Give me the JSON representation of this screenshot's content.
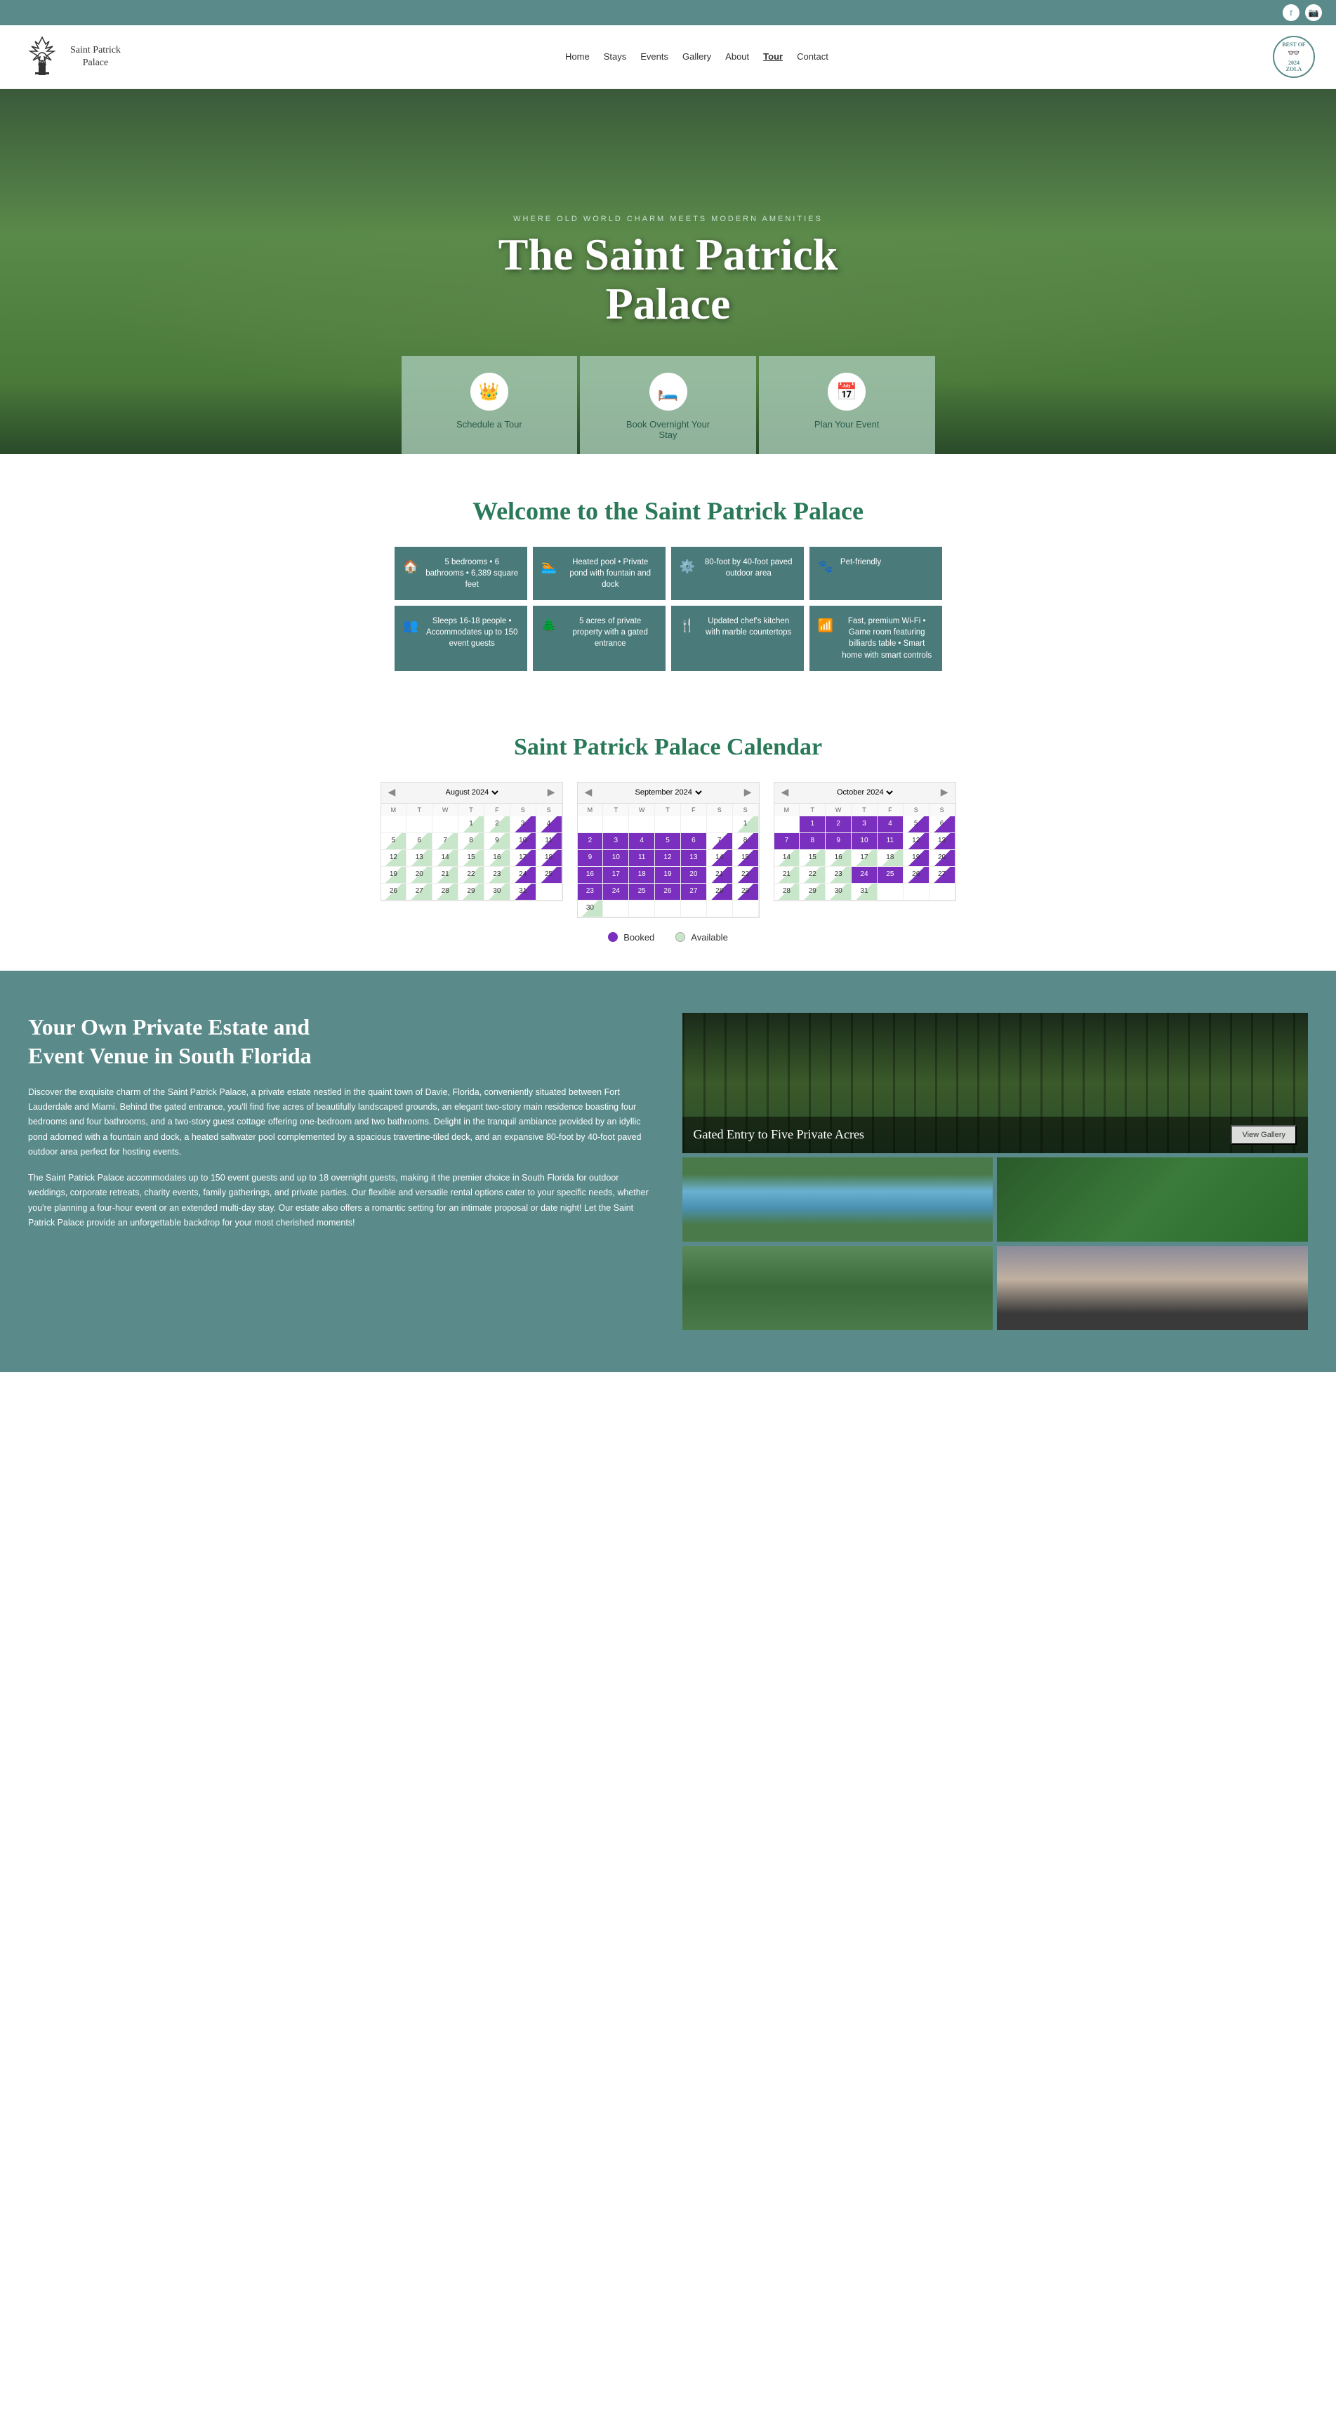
{
  "topbar": {
    "facebook_icon": "f",
    "instagram_icon": "ig"
  },
  "navbar": {
    "logo_line1": "Saint Patrick",
    "logo_line2": "Palace",
    "links": [
      {
        "label": "Home",
        "active": false
      },
      {
        "label": "Stays",
        "active": false
      },
      {
        "label": "Events",
        "active": false
      },
      {
        "label": "Gallery",
        "active": false
      },
      {
        "label": "About",
        "active": false
      },
      {
        "label": "Tour",
        "active": true
      },
      {
        "label": "Contact",
        "active": false
      }
    ],
    "badge_line1": "BEST OF",
    "badge_line2": "2024",
    "badge_line3": "ZOLA"
  },
  "hero": {
    "subtitle": "WHERE OLD WORLD CHARM MEETS MODERN AMENITIES",
    "title_line1": "The Saint Patrick",
    "title_line2": "Palace",
    "cta1": "Schedule a Tour",
    "cta2_line1": "Book Overnight Your",
    "cta2_line2": "Stay",
    "cta3": "Plan Your Event"
  },
  "welcome": {
    "heading": "Welcome to the Saint Patrick Palace"
  },
  "features": [
    {
      "icon": "🏠",
      "text": "5 bedrooms • 6 bathrooms • 6,389 square feet"
    },
    {
      "icon": "🏊",
      "text": "Heated pool • Private pond with fountain and dock"
    },
    {
      "icon": "⚙️",
      "text": "80-foot by 40-foot paved outdoor area"
    },
    {
      "icon": "🐾",
      "text": "Pet-friendly"
    },
    {
      "icon": "👥",
      "text": "Sleeps 16-18 people • Accommodates up to 150 event guests"
    },
    {
      "icon": "🌲",
      "text": "5 acres of private property with a gated entrance"
    },
    {
      "icon": "🍴",
      "text": "Updated chef's kitchen with marble countertops"
    },
    {
      "icon": "📶",
      "text": "Fast, premium Wi-Fi • Game room featuring billiards table • Smart home with smart controls"
    }
  ],
  "calendar": {
    "heading": "Saint Patrick Palace Calendar",
    "month1": "August 2024",
    "month2": "September 2024",
    "month3": "October 2024",
    "days_header": [
      "M",
      "T",
      "W",
      "T",
      "F",
      "S",
      "S"
    ],
    "legend_booked": "Booked",
    "legend_available": "Available",
    "booked_color": "#7b2fbe",
    "available_color": "#c8e6c9"
  },
  "about": {
    "heading_line1": "Your Own Private Estate and",
    "heading_line2": "Event Venue in South Florida",
    "para1": "Discover the exquisite charm of the Saint Patrick Palace, a private estate nestled in the quaint town of Davie, Florida, conveniently situated between Fort Lauderdale and Miami. Behind the gated entrance, you'll find five acres of beautifully landscaped grounds, an elegant two-story main residence boasting four bedrooms and four bathrooms, and a two-story guest cottage offering one-bedroom and two bathrooms. Delight in the tranquil ambiance provided by an idyllic pond adorned with a fountain and dock, a heated saltwater pool complemented by a spacious travertine-tiled deck, and an expansive 80-foot by 40-foot paved outdoor area perfect for hosting events.",
    "para2": "The Saint Patrick Palace accommodates up to 150 event guests and up to 18 overnight guests, making it the premier choice in South Florida for outdoor weddings, corporate retreats, charity events, family gatherings, and private parties. Our flexible and versatile rental options cater to your specific needs, whether you're planning a four-hour event or an extended multi-day stay. Our estate also offers a romantic setting for an intimate proposal or date night! Let the Saint Patrick Palace provide an unforgettable backdrop for your most cherished moments!",
    "gallery_main_title": "Gated Entry to Five Private Acres",
    "view_gallery_btn": "View Gallery"
  }
}
